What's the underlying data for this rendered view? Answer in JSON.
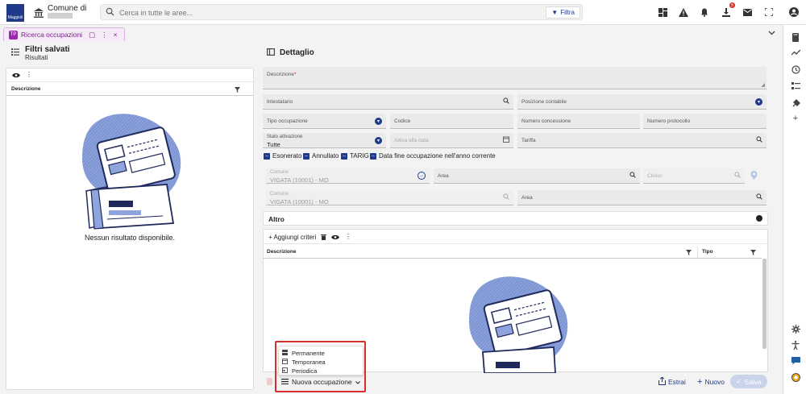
{
  "topbar": {
    "logo_text": "Maggioli",
    "comune_label": "Comune di",
    "search_placeholder": "Cerca in tutte le aree...",
    "filter_label": "Filtra",
    "download_badge": "8"
  },
  "tab": {
    "badge": "TP",
    "label": "Ricerca occupazioni",
    "pin": "▢",
    "more": "⋮",
    "close": "×"
  },
  "left": {
    "title": "Filtri salvati",
    "subtitle": "Risultati",
    "column_header": "Descrizione",
    "empty_message": "Nessun risultato disponibile."
  },
  "right": {
    "title": "Dettaglio",
    "fields": {
      "descrizione": "Descrizione",
      "intestatario": "Intestatario",
      "posizione_contabile": "Posizione contabile",
      "tipo_occupazione": "Tipo occupazione",
      "codice": "Codice",
      "numero_concessione": "Numero concessione",
      "numero_protocollo": "Numero protocollo",
      "stato_attivazione_label": "Stato attivazione",
      "stato_attivazione_value": "Tutte",
      "attiva_alla_data": "Attiva alla data",
      "tariffa": "Tariffa",
      "comune1_label": "Comune",
      "comune1_value": "VIGATA (10001) - MO",
      "area1": "Area",
      "civico": "Civico",
      "comune2_label": "Comune",
      "comune2_value": "VIGATA (10001) - MO",
      "area2": "Area"
    },
    "checkboxes": [
      "Esonerato",
      "Annullato",
      "TARIG",
      "Data fine occupazione nell'anno corrente"
    ],
    "altro_label": "Altro",
    "criteria": {
      "add_label": "+ Aggiungi criteri",
      "col_descrizione": "Descrizione",
      "col_tipo": "Tipo"
    }
  },
  "menu": {
    "items": [
      {
        "icon": "permanent-icon",
        "label": "Permanente"
      },
      {
        "icon": "calendar-icon",
        "label": "Temporanea"
      },
      {
        "icon": "periodic-icon",
        "label": "Periodica"
      }
    ],
    "trigger_label": "Nuova occupazione"
  },
  "actions": {
    "estrai": "Estrai",
    "nuovo": "Nuovo",
    "salva": "Salva"
  },
  "colors": {
    "primary": "#1f3a8a",
    "tab_accent": "#9c27b0",
    "highlight": "#d32f2f"
  }
}
